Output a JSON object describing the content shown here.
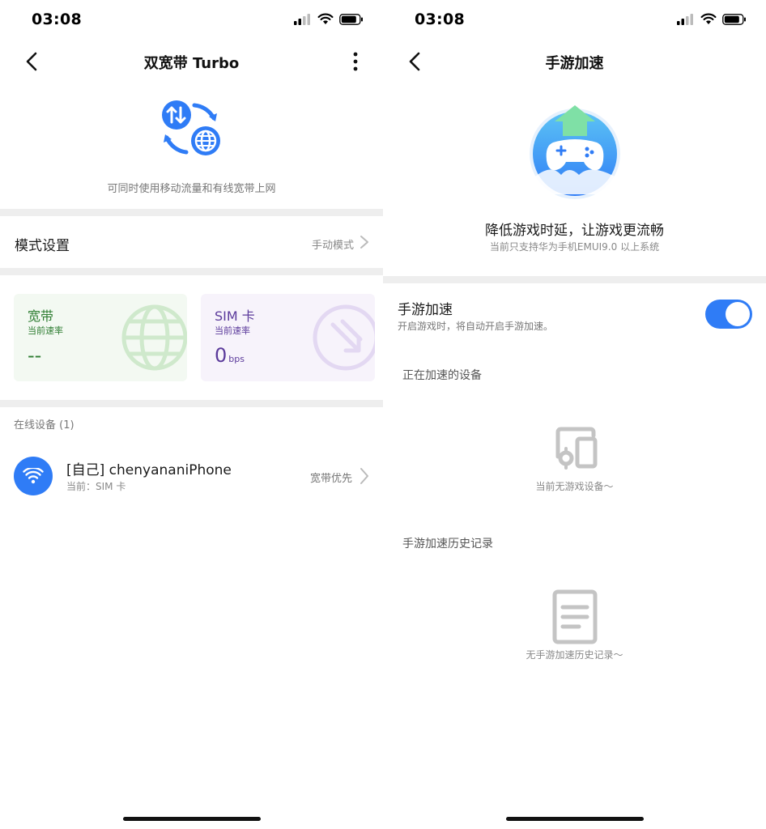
{
  "left_screen": {
    "status": {
      "time": "03:08"
    },
    "nav": {
      "title": "双宽带 Turbo"
    },
    "hero": {
      "description": "可同时使用移动流量和有线宽带上网"
    },
    "mode": {
      "label": "模式设置",
      "value": "手动模式"
    },
    "cards": {
      "broadband": {
        "title": "宽带",
        "subtitle": "当前速率",
        "value": "--",
        "unit": ""
      },
      "sim": {
        "title": "SIM 卡",
        "subtitle": "当前速率",
        "value": "0",
        "unit": "bps"
      }
    },
    "online": {
      "header": "在线设备 (1)",
      "devices": [
        {
          "name": "[自己] chenyananiPhone",
          "sub": "当前：SIM 卡",
          "preference": "宽带优先"
        }
      ]
    }
  },
  "right_screen": {
    "status": {
      "time": "03:08"
    },
    "nav": {
      "title": "手游加速"
    },
    "hero": {
      "headline": "降低游戏时延，让游戏更流畅",
      "note": "当前只支持华为手机EMUI9.0 以上系统"
    },
    "toggle": {
      "label": "手游加速",
      "subtitle": "开启游戏时，将自动开启手游加速。",
      "on": true
    },
    "accelerating": {
      "title": "正在加速的设备",
      "empty_text": "当前无游戏设备～"
    },
    "history": {
      "title": "手游加速历史记录",
      "empty_text": "无手游加速历史记录～"
    }
  },
  "colors": {
    "accent": "#2f7cf6",
    "broadband_text": "#2e7d32",
    "broadband_bg": "#f3f9f2",
    "sim_text": "#5b3a9b",
    "sim_bg": "#f7f3fb",
    "divider": "#eeeeee"
  }
}
